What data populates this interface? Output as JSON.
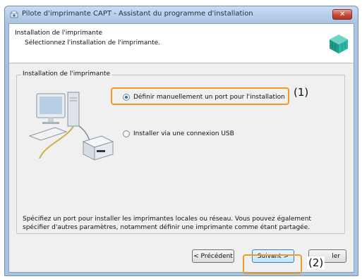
{
  "window": {
    "title": "Pilote d'imprimante CAPT - Assistant du programme d'installation"
  },
  "header": {
    "title": "Installation de l'imprimante",
    "subtitle": "Sélectionnez l'installation de l'imprimante."
  },
  "group": {
    "legend": "Installation de l'imprimante",
    "options": [
      {
        "label": "Définir manuellement un port pour l'installation",
        "selected": true
      },
      {
        "label": "Installer via une connexion USB",
        "selected": false
      }
    ],
    "description": "Spécifiez un port pour installer les imprimantes locales ou réseau. Vous pouvez également spécifier d'autres paramètres, notamment définir une imprimante comme étant partagée."
  },
  "buttons": {
    "back": "< Précédent",
    "next": "Suivant >",
    "cancel": "ler"
  },
  "callouts": {
    "first": "(1)",
    "second": "(2)"
  },
  "colors": {
    "highlight": "#f39a21",
    "title_bar": "#a9c3e2",
    "dialog_bg": "#f0f0f0"
  },
  "icons": [
    "app-icon",
    "close-icon",
    "printer-package-icon",
    "computer-printer-illustration"
  ]
}
